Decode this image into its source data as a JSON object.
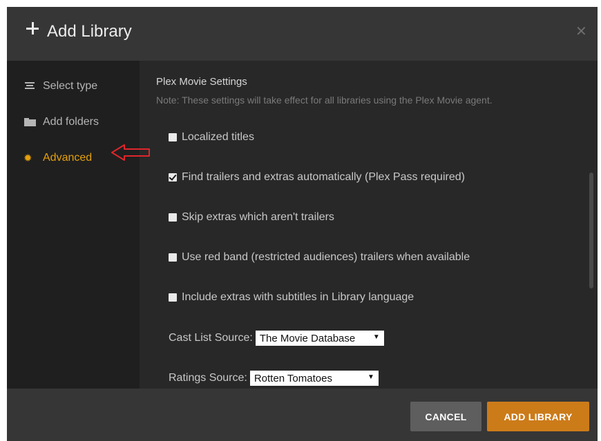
{
  "dialog": {
    "title": "Add Library",
    "plus_icon": "plus-icon",
    "close_icon": "close-icon",
    "close_glyph": "✕"
  },
  "sidebar": {
    "items": [
      {
        "label": "Select type",
        "icon": "list-icon",
        "active": false
      },
      {
        "label": "Add folders",
        "icon": "folder-icon",
        "active": false
      },
      {
        "label": "Advanced",
        "icon": "gear-icon",
        "active": true
      }
    ]
  },
  "main": {
    "heading": "Plex Movie Settings",
    "note": "Note: These settings will take effect for all libraries using the Plex Movie agent.",
    "options": [
      {
        "label": "Localized titles",
        "checked": false
      },
      {
        "label": "Find trailers and extras automatically (Plex Pass required)",
        "checked": true
      },
      {
        "label": "Skip extras which aren't trailers",
        "checked": false
      },
      {
        "label": "Use red band (restricted audiences) trailers when available",
        "checked": false
      },
      {
        "label": "Include extras with subtitles in Library language",
        "checked": false
      }
    ],
    "cast_list_source": {
      "label": "Cast List Source:",
      "value": "The Movie Database"
    },
    "ratings_source": {
      "label": "Ratings Source:",
      "value": "Rotten Tomatoes"
    }
  },
  "footer": {
    "cancel_label": "CANCEL",
    "add_label": "ADD LIBRARY"
  },
  "colors": {
    "accent": "#e5a00d",
    "add_button": "#cc7b19",
    "cancel_button": "#5e5e5e",
    "annotation_arrow": "#e0262b"
  }
}
